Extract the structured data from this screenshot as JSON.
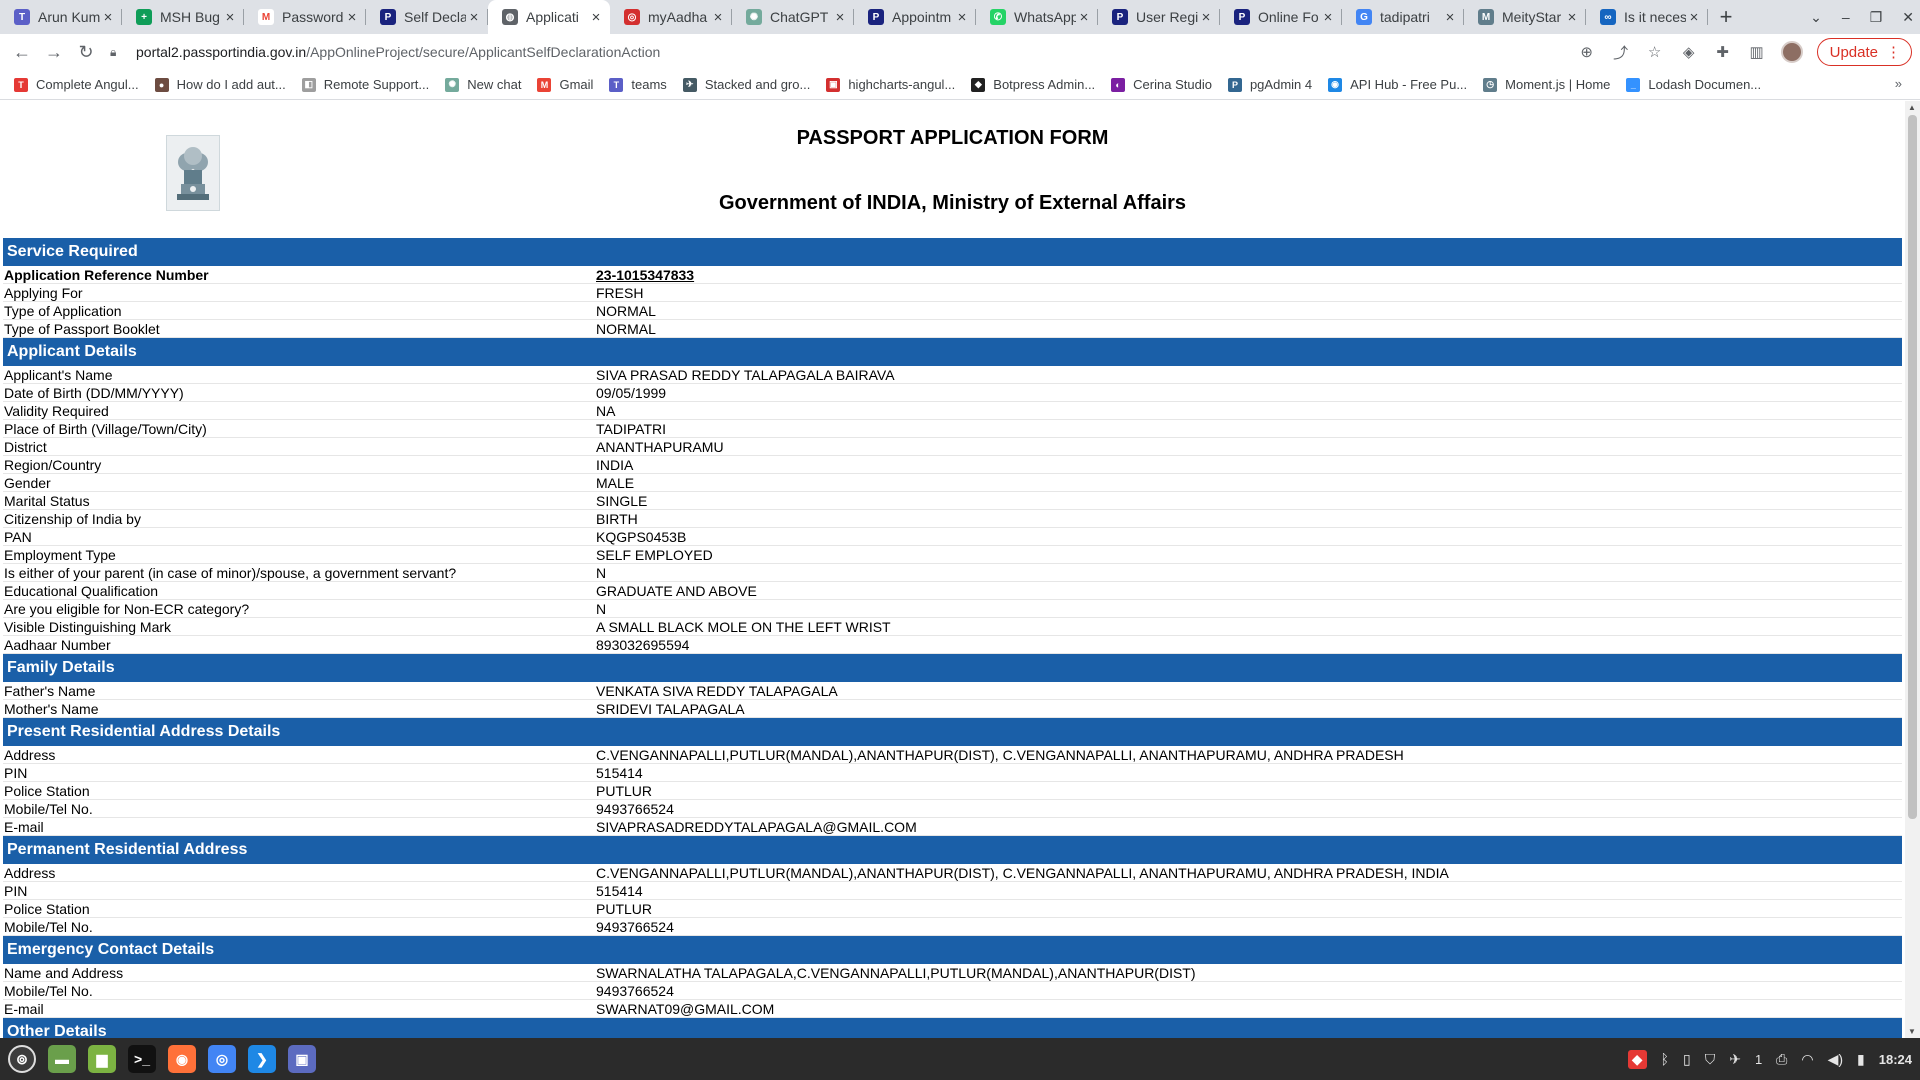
{
  "browser": {
    "tabs": [
      {
        "title": "Arun Kum",
        "fav_color": "#5b5fc7",
        "fav_glyph": "T",
        "active": false
      },
      {
        "title": "MSH Bug",
        "fav_color": "#0f9d58",
        "fav_glyph": "+",
        "active": false
      },
      {
        "title": "Password",
        "fav_color": "#ffffff",
        "fav_glyph": "M",
        "active": false
      },
      {
        "title": "Self Decla",
        "fav_color": "#1a237e",
        "fav_glyph": "P",
        "active": false
      },
      {
        "title": "Applicati",
        "fav_color": "#5f6368",
        "fav_glyph": "◍",
        "active": true
      },
      {
        "title": "myAadha",
        "fav_color": "#d32f2f",
        "fav_glyph": "◎",
        "active": false
      },
      {
        "title": "ChatGPT",
        "fav_color": "#74aa9c",
        "fav_glyph": "✺",
        "active": false
      },
      {
        "title": "Appointm",
        "fav_color": "#1a237e",
        "fav_glyph": "P",
        "active": false
      },
      {
        "title": "WhatsApp",
        "fav_color": "#25d366",
        "fav_glyph": "✆",
        "active": false
      },
      {
        "title": "User Regi",
        "fav_color": "#1a237e",
        "fav_glyph": "P",
        "active": false
      },
      {
        "title": "Online Fo",
        "fav_color": "#1a237e",
        "fav_glyph": "P",
        "active": false
      },
      {
        "title": "tadipatri",
        "fav_color": "#4285f4",
        "fav_glyph": "G",
        "active": false
      },
      {
        "title": "MeityStar",
        "fav_color": "#607d8b",
        "fav_glyph": "M",
        "active": false
      },
      {
        "title": "Is it neces",
        "fav_color": "#1565c0",
        "fav_glyph": "∞",
        "active": false
      }
    ],
    "new_tab": "+",
    "url_host": "portal2.passportindia.gov.in",
    "url_path": "/AppOnlineProject/secure/ApplicantSelfDeclarationAction",
    "update_label": "Update",
    "bookmarks": [
      {
        "label": "Complete Angul...",
        "color": "#e53935",
        "glyph": "T"
      },
      {
        "label": "How do I add aut...",
        "color": "#6d4c41",
        "glyph": "●"
      },
      {
        "label": "Remote Support...",
        "color": "#9e9e9e",
        "glyph": "◧"
      },
      {
        "label": "New chat",
        "color": "#74aa9c",
        "glyph": "✺"
      },
      {
        "label": "Gmail",
        "color": "#ea4335",
        "glyph": "M"
      },
      {
        "label": "teams",
        "color": "#5b5fc7",
        "glyph": "T"
      },
      {
        "label": "Stacked and gro...",
        "color": "#455a64",
        "glyph": "✈"
      },
      {
        "label": "highcharts-angul...",
        "color": "#d32f2f",
        "glyph": "▣"
      },
      {
        "label": "Botpress Admin...",
        "color": "#212121",
        "glyph": "◆"
      },
      {
        "label": "Cerina Studio",
        "color": "#7b1fa2",
        "glyph": "◐"
      },
      {
        "label": "pgAdmin 4",
        "color": "#336791",
        "glyph": "P"
      },
      {
        "label": "API Hub - Free Pu...",
        "color": "#1e88e5",
        "glyph": "◉"
      },
      {
        "label": "Moment.js | Home",
        "color": "#607d8b",
        "glyph": "◷"
      },
      {
        "label": "Lodash Documen...",
        "color": "#3492ff",
        "glyph": "_"
      }
    ],
    "bookmarks_more": "»"
  },
  "page": {
    "title": "PASSPORT APPLICATION FORM",
    "subtitle": "Government of INDIA, Ministry of External Affairs",
    "emblem_text": "सत्यमेव जयते",
    "sections": [
      {
        "heading": "Service Required",
        "rows": [
          {
            "label": "Application Reference Number",
            "value": "23-1015347833",
            "bold_label": true,
            "ref": true
          },
          {
            "label": "Applying For",
            "value": "FRESH"
          },
          {
            "label": "Type of Application",
            "value": "NORMAL"
          },
          {
            "label": "Type of Passport Booklet",
            "value": "NORMAL"
          }
        ]
      },
      {
        "heading": "Applicant Details",
        "rows": [
          {
            "label": "Applicant's Name",
            "value": "SIVA PRASAD REDDY TALAPAGALA BAIRAVA"
          },
          {
            "label": "Date of Birth (DD/MM/YYYY)",
            "value": "09/05/1999"
          },
          {
            "label": "Validity Required",
            "value": "NA"
          },
          {
            "label": "Place of Birth (Village/Town/City)",
            "value": "TADIPATRI"
          },
          {
            "label": "District",
            "value": "ANANTHAPURAMU"
          },
          {
            "label": "Region/Country",
            "value": "INDIA"
          },
          {
            "label": "Gender",
            "value": "MALE"
          },
          {
            "label": "Marital Status",
            "value": "SINGLE"
          },
          {
            "label": "Citizenship of India by",
            "value": "BIRTH"
          },
          {
            "label": "PAN",
            "value": "KQGPS0453B"
          },
          {
            "label": "Employment Type",
            "value": "SELF EMPLOYED"
          },
          {
            "label": "Is either of your parent (in case of minor)/spouse, a government servant?",
            "value": "N"
          },
          {
            "label": "Educational Qualification",
            "value": "GRADUATE AND ABOVE"
          },
          {
            "label": "Are you eligible for Non-ECR category?",
            "value": "N"
          },
          {
            "label": "Visible Distinguishing Mark",
            "value": "A SMALL BLACK MOLE ON THE LEFT WRIST"
          },
          {
            "label": "Aadhaar Number",
            "value": "893032695594"
          }
        ]
      },
      {
        "heading": "Family Details",
        "rows": [
          {
            "label": "Father's Name",
            "value": "VENKATA SIVA REDDY TALAPAGALA"
          },
          {
            "label": "Mother's Name",
            "value": "SRIDEVI TALAPAGALA"
          }
        ]
      },
      {
        "heading": "Present Residential Address Details",
        "rows": [
          {
            "label": "Address",
            "value": "C.VENGANNAPALLI,PUTLUR(MANDAL),ANANTHAPUR(DIST), C.VENGANNAPALLI, ANANTHAPURAMU, ANDHRA PRADESH"
          },
          {
            "label": "PIN",
            "value": "515414"
          },
          {
            "label": "Police Station",
            "value": "PUTLUR"
          },
          {
            "label": "Mobile/Tel No.",
            "value": "9493766524"
          },
          {
            "label": "E-mail",
            "value": "SIVAPRASADREDDYTALAPAGALA@GMAIL.COM"
          }
        ]
      },
      {
        "heading": "Permanent Residential Address",
        "rows": [
          {
            "label": "Address",
            "value": "C.VENGANNAPALLI,PUTLUR(MANDAL),ANANTHAPUR(DIST), C.VENGANNAPALLI, ANANTHAPURAMU, ANDHRA PRADESH, INDIA"
          },
          {
            "label": "PIN",
            "value": "515414"
          },
          {
            "label": "Police Station",
            "value": "PUTLUR"
          },
          {
            "label": "Mobile/Tel No.",
            "value": "9493766524"
          }
        ]
      },
      {
        "heading": "Emergency Contact Details",
        "rows": [
          {
            "label": "Name and Address",
            "value": "SWARNALATHA TALAPAGALA,C.VENGANNAPALLI,PUTLUR(MANDAL),ANANTHAPUR(DIST)"
          },
          {
            "label": "Mobile/Tel No.",
            "value": "9493766524"
          },
          {
            "label": "E-mail",
            "value": "SWARNAT09@GMAIL.COM"
          }
        ]
      },
      {
        "heading": "Other Details",
        "rows": []
      }
    ]
  },
  "taskbar": {
    "apps": [
      {
        "name": "menu",
        "color": "#3c3c3c",
        "glyph": "⊚"
      },
      {
        "name": "files",
        "color": "#6a9f4b",
        "glyph": "▬"
      },
      {
        "name": "folder",
        "color": "#7cb342",
        "glyph": "▆"
      },
      {
        "name": "terminal",
        "color": "#111111",
        "glyph": ">_"
      },
      {
        "name": "firefox",
        "color": "#ff7139",
        "glyph": "◉"
      },
      {
        "name": "chrome",
        "color": "#4285f4",
        "glyph": "◎"
      },
      {
        "name": "vscode",
        "color": "#1e88e5",
        "glyph": "❯"
      },
      {
        "name": "screenshot",
        "color": "#5c6bc0",
        "glyph": "▣"
      }
    ],
    "tray_badge": "1",
    "clock": "18:24"
  },
  "colors": {
    "section_bg": "#1a5fa8",
    "update_red": "#d93025"
  }
}
